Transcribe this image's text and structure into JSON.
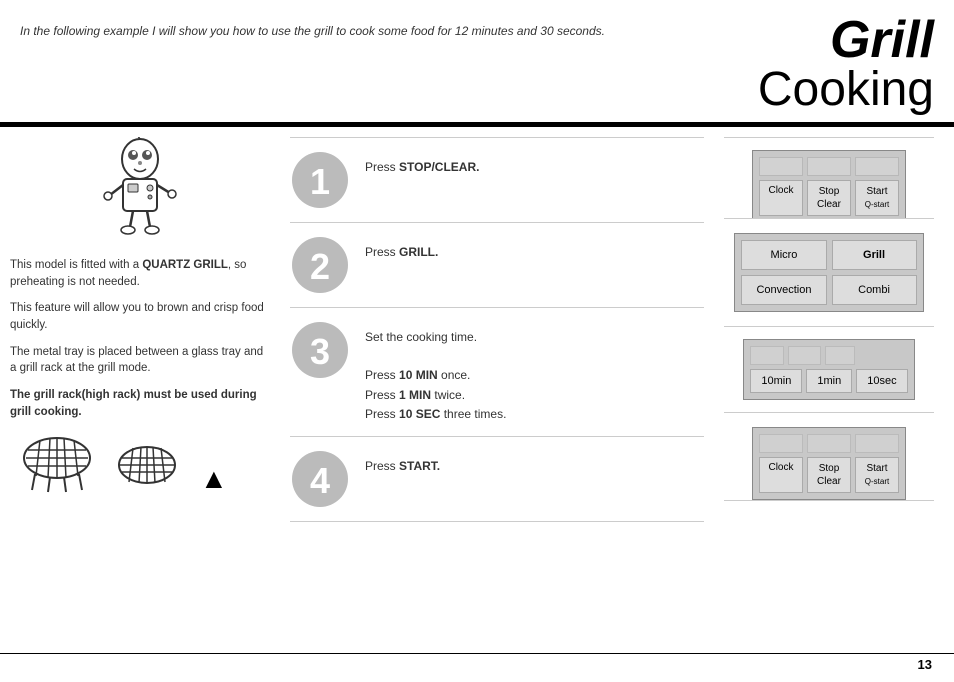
{
  "header": {
    "intro": "In the following example I will show you how to use the grill to cook some food for 12 minutes and 30 seconds.",
    "title_grill": "Grill",
    "title_cooking": "Cooking"
  },
  "left": {
    "text1": "This model is fitted with a ",
    "text1b": "QUARTZ GRILL",
    "text1c": ", so preheating is not needed.",
    "text2": "This feature will allow you to brown and crisp food quickly.",
    "text3": "The metal tray is placed between a glass tray and a grill rack at the grill mode.",
    "text4b": "The grill rack(high rack) must be used during grill cooking."
  },
  "steps": [
    {
      "number": "1",
      "instruction": "Press ",
      "instruction_bold": "STOP/CLEAR.",
      "instruction_after": ""
    },
    {
      "number": "2",
      "instruction": "Press ",
      "instruction_bold": "GRILL.",
      "instruction_after": ""
    },
    {
      "number": "3",
      "instruction_lines": [
        {
          "text": "Set the cooking time.",
          "bold": false
        },
        {
          "text": "",
          "bold": false
        },
        {
          "text": "Press ",
          "bold": false,
          "bold_part": "10 MIN",
          "after": " once."
        },
        {
          "text": "Press ",
          "bold": false,
          "bold_part": "1 MIN",
          "after": " twice."
        },
        {
          "text": "Press ",
          "bold": false,
          "bold_part": "10 SEC",
          "after": " three times."
        }
      ]
    },
    {
      "number": "4",
      "instruction": "Press ",
      "instruction_bold": "START.",
      "instruction_after": ""
    }
  ],
  "panels": {
    "panel1": {
      "row1": [
        "Clock",
        "Stop\nClear",
        "Start\nQ-start"
      ]
    },
    "panel2": {
      "buttons": [
        "Micro",
        "Grill",
        "Convection",
        "Combi"
      ]
    },
    "panel3": {
      "buttons": [
        "10min",
        "1min",
        "10sec"
      ]
    },
    "panel4": {
      "row1": [
        "Clock",
        "Stop\nClear",
        "Start\nQ-start"
      ]
    }
  },
  "page_number": "13",
  "clear_label": "Clear",
  "convection_label": "Convection",
  "grill_cooking_label": "Grill Cooking"
}
